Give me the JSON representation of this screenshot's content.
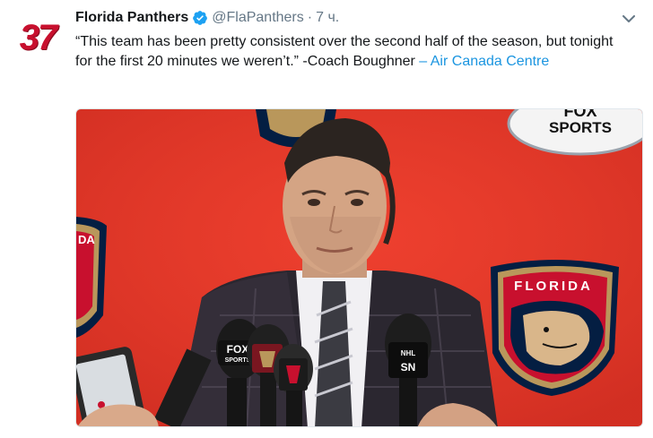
{
  "tweet": {
    "avatar_text": "37",
    "display_name": "Florida Panthers",
    "handle": "@FlaPanthers",
    "separator": "·",
    "time": "7 ч.",
    "text_quote": "“This team has been pretty consistent over the second half of the season, but tonight for the first 20 minutes we weren’t.” -Coach Boughner ",
    "location_link": "– Air Canada Centre"
  },
  "media": {
    "backdrop_logo_text": "FLORIDA",
    "partial_logo_text": "DA",
    "sports_logo_text": "SPORTS",
    "fox_logo_text": "FOX",
    "mic_sn_text": "SN",
    "mic_nhl_text": "NHL",
    "mic_fox_text": "FOX",
    "mic_fox_sub": "SPORTS"
  },
  "colors": {
    "backdrop": "#e8372a",
    "panther_red": "#c8102e",
    "navy": "#041e42",
    "gold": "#b9975b",
    "link": "#1b95e0",
    "verified": "#1da1f2",
    "muted": "#657786"
  },
  "icons": {
    "verified": "verified-badge-icon",
    "caret": "chevron-down-icon"
  }
}
